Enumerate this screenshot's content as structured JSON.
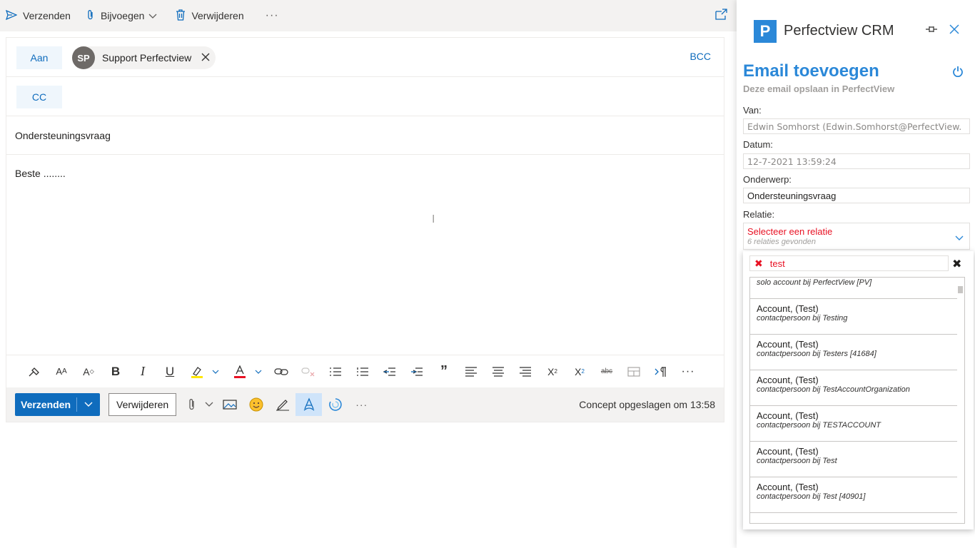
{
  "toolbar": {
    "send_label": "Verzenden",
    "attach_label": "Bijvoegen",
    "delete_label": "Verwijderen",
    "more_label": "···"
  },
  "compose": {
    "to_label": "Aan",
    "cc_label": "CC",
    "bcc_label": "BCC",
    "recipient": {
      "initials": "SP",
      "name": "Support Perfectview"
    },
    "subject": "Ondersteuningsvraag",
    "body": "Beste ........",
    "send_label": "Verzenden",
    "discard_label": "Verwijderen",
    "draft_status": "Concept opgeslagen om 13:58",
    "more_label": "···"
  },
  "pane": {
    "app_name": "Perfectview CRM",
    "logo_letter": "P",
    "heading": "Email toevoegen",
    "subheading": "Deze email opslaan in PerfectView",
    "from_label": "Van:",
    "from_value": "Edwin Somhorst (Edwin.Somhorst@PerfectView.",
    "date_label": "Datum:",
    "date_value": "12-7-2021 13:59:24",
    "subject_label": "Onderwerp:",
    "subject_value": "Ondersteuningsvraag",
    "relation_label": "Relatie:",
    "relation_placeholder": "Selecteer een relatie",
    "relation_count": "6 relaties gevonden",
    "search_value": "test",
    "results_first": "solo account bij PerfectView [PV]",
    "results": [
      {
        "name": "Account, (Test)",
        "detail": "contactpersoon bij Testing"
      },
      {
        "name": "Account, (Test)",
        "detail": "contactpersoon bij Testers [41684]"
      },
      {
        "name": "Account, (Test)",
        "detail": "contactpersoon bij TestAccountOrganization"
      },
      {
        "name": "Account, (Test)",
        "detail": "contactpersoon bij TESTACCOUNT"
      },
      {
        "name": "Account, (Test)",
        "detail": "contactpersoon bij Test"
      },
      {
        "name": "Account, (Test)",
        "detail": "contactpersoon bij Test [40901]"
      }
    ]
  },
  "colors": {
    "accent": "#0f6cbd",
    "crm_blue": "#2b88d8",
    "error_red": "#e81123"
  }
}
